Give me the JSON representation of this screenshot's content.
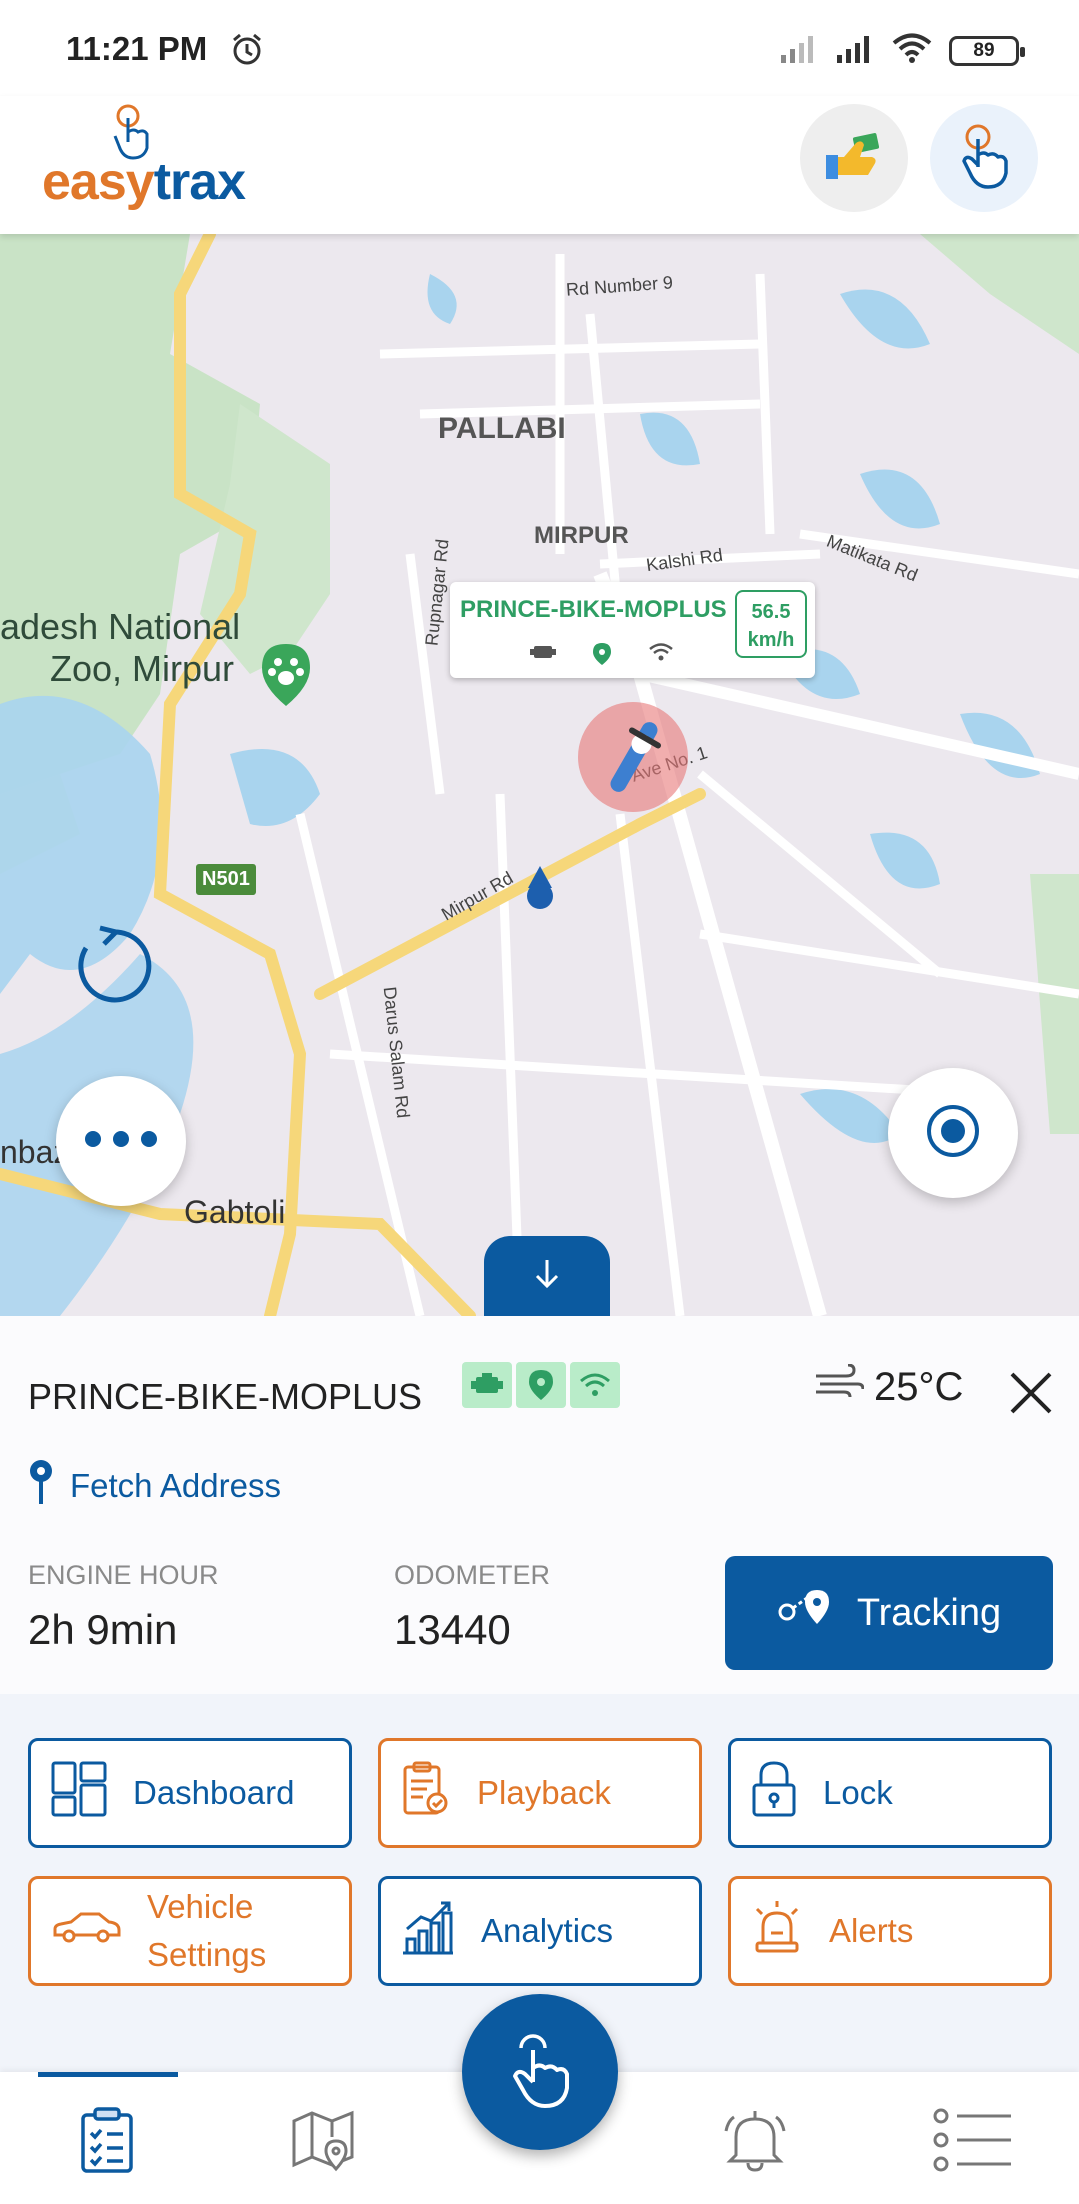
{
  "status_bar": {
    "time": "11:21 PM",
    "battery": "89"
  },
  "header": {
    "logo_easy": "easy",
    "logo_trax": "trax"
  },
  "map": {
    "labels": {
      "pallabi": "PALLABI",
      "mirpur": "MIRPUR",
      "zoo_line1": "adesh National",
      "zoo_line2": "Zoo, Mirpur",
      "gabtoli": "Gabtoli",
      "left_edge": "nbaz",
      "highway": "N501"
    },
    "roads": {
      "rd9": "Rd Number 9",
      "kalshi": "Kalshi Rd",
      "matikata": "Matikata Rd",
      "rupnagar": "Rupnagar Rd",
      "ave1": "Ave No. 1",
      "mirpur_rd": "Mirpur Rd",
      "darus_salam": "Darus Salam Rd"
    },
    "vehicle_card": {
      "name": "PRINCE-BIKE-MOPLUS",
      "speed": "56.5",
      "speed_unit": "km/h"
    }
  },
  "details": {
    "vehicle_name": "PRINCE-BIKE-MOPLUS",
    "temperature": "25°C",
    "fetch_address": "Fetch Address",
    "engine_hour_label": "ENGINE HOUR",
    "engine_hour_value": "2h 9min",
    "odometer_label": "ODOMETER",
    "odometer_value": "13440",
    "tracking_label": "Tracking"
  },
  "quick_actions": {
    "dashboard": "Dashboard",
    "playback": "Playback",
    "lock": "Lock",
    "vehicle_settings_1": "Vehicle",
    "vehicle_settings_2": "Settings",
    "analytics": "Analytics",
    "alerts": "Alerts"
  },
  "colors": {
    "brand_blue": "#0b5aa0",
    "brand_orange": "#e0772a",
    "status_green": "#2e9e63"
  }
}
